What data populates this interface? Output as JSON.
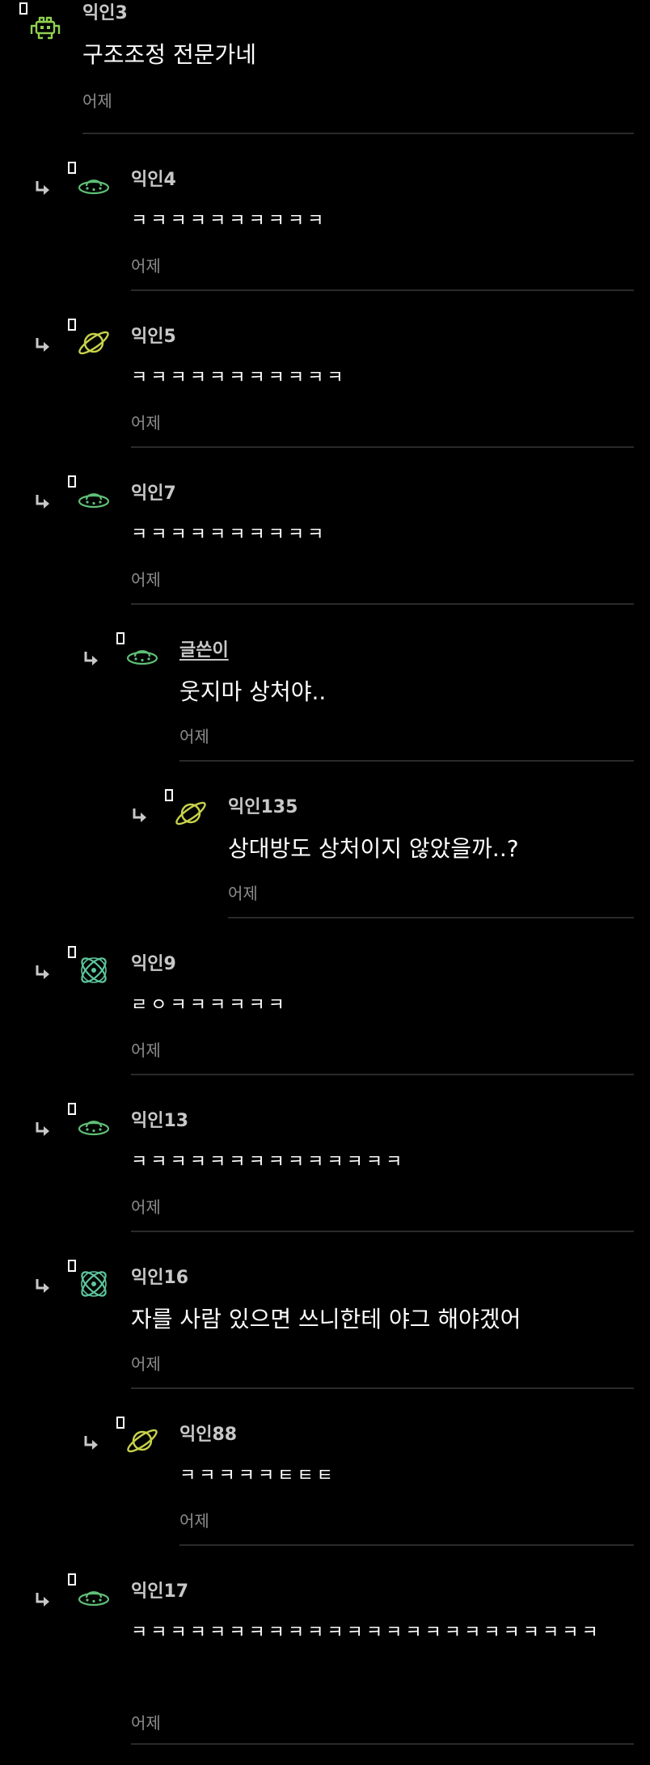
{
  "comments": [
    {
      "author": "익인3",
      "avatar_icon": "space-invader-icon",
      "avatar_color": "#8fd14f",
      "text": "구조조정 전문가네",
      "time": "어제"
    },
    {
      "author": "익인4",
      "avatar_icon": "ufo-icon",
      "avatar_color": "#5fbf76",
      "text": "ㅋㅋㅋㅋㅋㅋㅋㅋㅋㅋ",
      "time": "어제"
    },
    {
      "author": "익인5",
      "avatar_icon": "planet-icon",
      "avatar_color": "#c8d24a",
      "text": "ㅋㅋㅋㅋㅋㅋㅋㅋㅋㅋㅋ",
      "time": "어제"
    },
    {
      "author": "익인7",
      "avatar_icon": "ufo-icon",
      "avatar_color": "#5fbf76",
      "text": "ㅋㅋㅋㅋㅋㅋㅋㅋㅋㅋ",
      "time": "어제"
    },
    {
      "author": "글쓴이",
      "is_op": true,
      "avatar_icon": "ufo-icon",
      "avatar_color": "#5fbf76",
      "text": "웃지마 상처야..",
      "time": "어제"
    },
    {
      "author": "익인135",
      "avatar_icon": "planet-icon",
      "avatar_color": "#c8d24a",
      "text": "상대방도 상처이지 않았을까..?",
      "time": "어제"
    },
    {
      "author": "익인9",
      "avatar_icon": "atom-icon",
      "avatar_color": "#5cc79c",
      "text": "ㄹㅇㅋㅋㅋㅋㅋㅋ",
      "time": "어제"
    },
    {
      "author": "익인13",
      "avatar_icon": "ufo-icon",
      "avatar_color": "#5fbf76",
      "text": "ㅋㅋㅋㅋㅋㅋㅋㅋㅋㅋㅋㅋㅋㅋ",
      "time": "어제"
    },
    {
      "author": "익인16",
      "avatar_icon": "atom-icon",
      "avatar_color": "#5cc79c",
      "text": "자를 사람 있으면 쓰니한테 야그 해야겠어",
      "time": "어제"
    },
    {
      "author": "익인88",
      "avatar_icon": "planet-icon",
      "avatar_color": "#c8d24a",
      "text": "ㅋㅋㅋㅋㅋㅌㅌㅌ",
      "time": "어제"
    },
    {
      "author": "익인17",
      "avatar_icon": "ufo-icon",
      "avatar_color": "#5fbf76",
      "text": "ㅋㅋㅋㅋㅋㅋㅋㅋㅋㅋㅋㅋㅋㅋㅋㅋㅋㅋㅋㅋㅋㅋㅋㅋ",
      "time": "어제"
    }
  ]
}
